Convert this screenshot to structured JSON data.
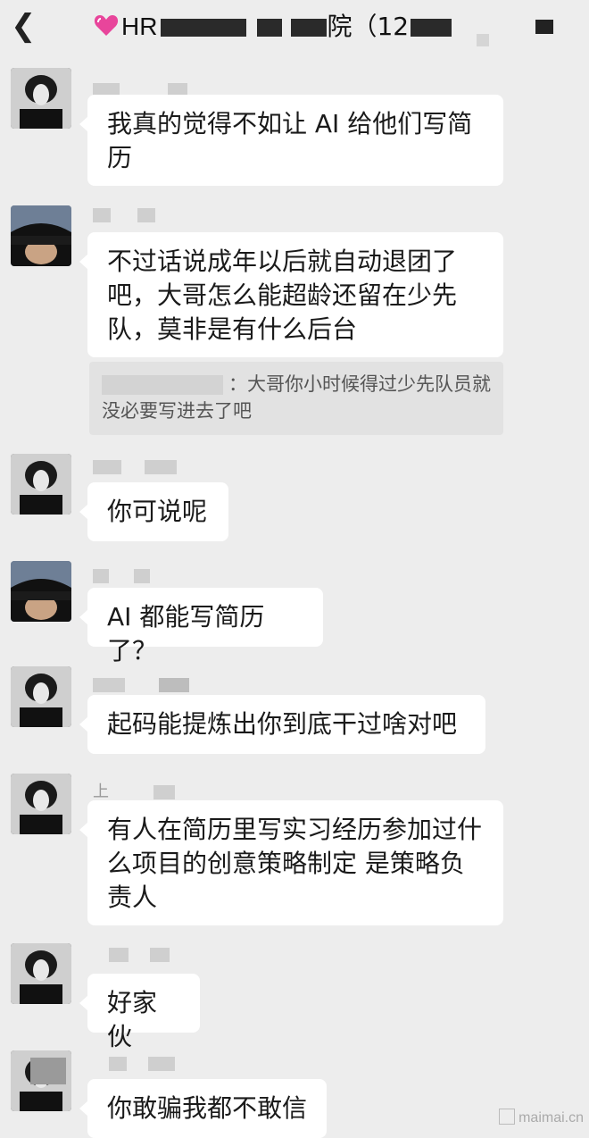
{
  "header": {
    "back_icon": "chevron-left-icon",
    "title_prefix": "HR",
    "title_partial_char": "院",
    "title_count": "（12"
  },
  "messages": [
    {
      "avatar": "avatar-a",
      "text": "我真的觉得不如让 AI 给他们写简历"
    },
    {
      "avatar": "avatar-b",
      "text": "不过话说成年以后就自动退团了吧，大哥怎么能超龄还留在少先队，莫非是有什么后台"
    },
    {
      "avatar": "avatar-a",
      "text": "你可说呢"
    },
    {
      "avatar": "avatar-b",
      "text": "AI 都能写简历了？"
    },
    {
      "avatar": "avatar-a",
      "text": "起码能提炼出你到底干过啥对吧"
    },
    {
      "avatar": "avatar-a",
      "text": "有人在简历里写实习经历参加过什么项目的创意策略制定 是策略负责人"
    },
    {
      "avatar": "avatar-a",
      "text": "好家伙"
    },
    {
      "avatar": "avatar-a",
      "text": "你敢骗我都不敢信"
    }
  ],
  "quote": {
    "text": "：大哥你小时候得过少先队员就没必要写进去了吧"
  },
  "nick_partial": "上",
  "watermark": "maimai.cn"
}
